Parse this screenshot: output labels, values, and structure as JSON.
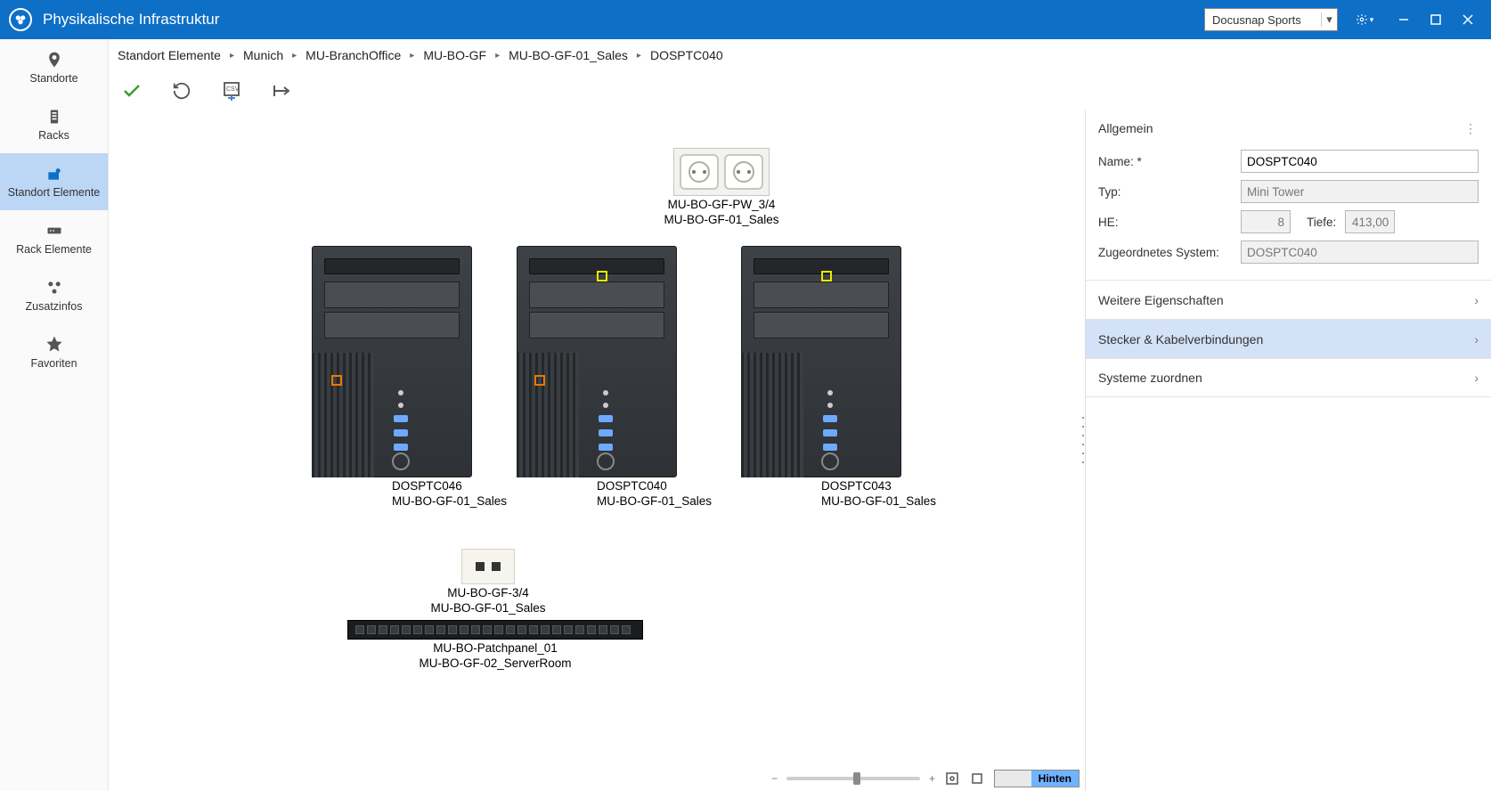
{
  "title": "Physikalische Infrastruktur",
  "tenant_dropdown": "Docusnap Sports",
  "nav": {
    "standorte": "Standorte",
    "racks": "Racks",
    "standort_elemente": "Standort Elemente",
    "rack_elemente": "Rack Elemente",
    "zusatzinfos": "Zusatzinfos",
    "favoriten": "Favoriten"
  },
  "breadcrumb": {
    "root": "Standort Elemente",
    "p1": "Munich",
    "p2": "MU-BranchOffice",
    "p3": "MU-BO-GF",
    "p4": "MU-BO-GF-01_Sales",
    "p5": "DOSPTC040"
  },
  "devices": {
    "outlet": {
      "l1": "MU-BO-GF-PW_3/4",
      "l2": "MU-BO-GF-01_Sales"
    },
    "pc1": {
      "l1": "DOSPTC046",
      "l2": "MU-BO-GF-01_Sales"
    },
    "pc2": {
      "l1": "DOSPTC040",
      "l2": "MU-BO-GF-01_Sales"
    },
    "pc3": {
      "l1": "DOSPTC043",
      "l2": "MU-BO-GF-01_Sales"
    },
    "walljack": {
      "l1": "MU-BO-GF-3/4",
      "l2": "MU-BO-GF-01_Sales"
    },
    "patch": {
      "l1": "MU-BO-Patchpanel_01",
      "l2": "MU-BO-GF-02_ServerRoom"
    }
  },
  "footer": {
    "hinten": "Hinten"
  },
  "props": {
    "section_general": "Allgemein",
    "name_label": "Name: *",
    "name_value": "DOSPTC040",
    "typ_label": "Typ:",
    "typ_value": "Mini Tower",
    "he_label": "HE:",
    "he_value": "8",
    "tiefe_label": "Tiefe:",
    "tiefe_value": "413,00",
    "zsys_label": "Zugeordnetes System:",
    "zsys_value": "DOSPTC040",
    "exp_more": "Weitere Eigenschaften",
    "exp_cable": "Stecker & Kabelverbindungen",
    "exp_assign": "Systeme zuordnen"
  }
}
